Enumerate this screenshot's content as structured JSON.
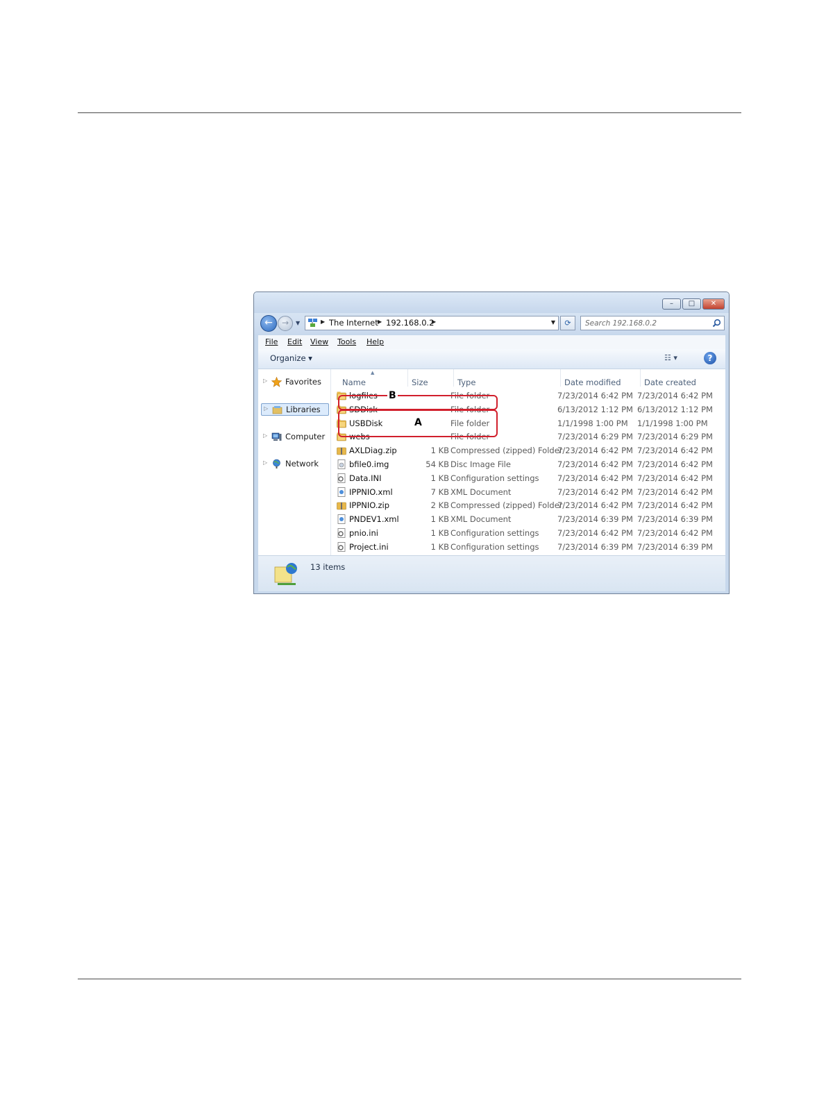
{
  "window": {
    "controls": {
      "minimize": "–",
      "maximize": "□",
      "close": "✕"
    }
  },
  "navigation": {
    "back_glyph": "←",
    "forward_glyph": "→",
    "address": {
      "crumbs": [
        "The Internet",
        "192.168.0.2"
      ]
    },
    "search": {
      "placeholder": "Search 192.168.0.2"
    }
  },
  "menu": [
    "File",
    "Edit",
    "View",
    "Tools",
    "Help"
  ],
  "toolbar": {
    "organize": "Organize ▾",
    "view_options": "☷ ▾",
    "help": "?"
  },
  "sidebar": {
    "items": [
      {
        "label": "Favorites",
        "icon": "star-icon"
      },
      {
        "label": "Libraries",
        "icon": "libraries-icon",
        "selected": true
      },
      {
        "label": "Computer",
        "icon": "computer-icon"
      },
      {
        "label": "Network",
        "icon": "network-icon"
      }
    ]
  },
  "columns": [
    "Name",
    "Size",
    "Type",
    "Date modified",
    "Date created"
  ],
  "files": [
    {
      "name": "logfiles",
      "size": "",
      "type": "File folder",
      "modified": "7/23/2014 6:42 PM",
      "created": "7/23/2014 6:42 PM",
      "icon": "folder-icon"
    },
    {
      "name": "SDDisk",
      "size": "",
      "type": "File folder",
      "modified": "6/13/2012 1:12 PM",
      "created": "6/13/2012 1:12 PM",
      "icon": "folder-icon"
    },
    {
      "name": "USBDisk",
      "size": "",
      "type": "File folder",
      "modified": "1/1/1998 1:00 PM",
      "created": "1/1/1998 1:00 PM",
      "icon": "folder-icon"
    },
    {
      "name": "webs",
      "size": "",
      "type": "File folder",
      "modified": "7/23/2014 6:29 PM",
      "created": "7/23/2014 6:29 PM",
      "icon": "folder-icon"
    },
    {
      "name": "AXLDiag.zip",
      "size": "1 KB",
      "type": "Compressed (zipped) Folder",
      "modified": "7/23/2014 6:42 PM",
      "created": "7/23/2014 6:42 PM",
      "icon": "zip-folder-icon"
    },
    {
      "name": "bfile0.img",
      "size": "54 KB",
      "type": "Disc Image File",
      "modified": "7/23/2014 6:42 PM",
      "created": "7/23/2014 6:42 PM",
      "icon": "file-icon"
    },
    {
      "name": "Data.INI",
      "size": "1 KB",
      "type": "Configuration settings",
      "modified": "7/23/2014 6:42 PM",
      "created": "7/23/2014 6:42 PM",
      "icon": "settings-file-icon"
    },
    {
      "name": "IPPNIO.xml",
      "size": "7 KB",
      "type": "XML Document",
      "modified": "7/23/2014 6:42 PM",
      "created": "7/23/2014 6:42 PM",
      "icon": "xml-file-icon"
    },
    {
      "name": "IPPNIO.zip",
      "size": "2 KB",
      "type": "Compressed (zipped) Folder",
      "modified": "7/23/2014 6:42 PM",
      "created": "7/23/2014 6:42 PM",
      "icon": "zip-folder-icon"
    },
    {
      "name": "PNDEV1.xml",
      "size": "1 KB",
      "type": "XML Document",
      "modified": "7/23/2014 6:39 PM",
      "created": "7/23/2014 6:39 PM",
      "icon": "xml-file-icon"
    },
    {
      "name": "pnio.ini",
      "size": "1 KB",
      "type": "Configuration settings",
      "modified": "7/23/2014 6:42 PM",
      "created": "7/23/2014 6:42 PM",
      "icon": "settings-file-icon"
    },
    {
      "name": "Project.ini",
      "size": "1 KB",
      "type": "Configuration settings",
      "modified": "7/23/2014 6:39 PM",
      "created": "7/23/2014 6:39 PM",
      "icon": "settings-file-icon"
    }
  ],
  "callouts": {
    "b": "B",
    "a": "A"
  },
  "status": {
    "text": "13 items"
  },
  "colors": {
    "callout": "#d11f2c",
    "folder": "#e8b84a",
    "selection": "#dcebfc"
  }
}
